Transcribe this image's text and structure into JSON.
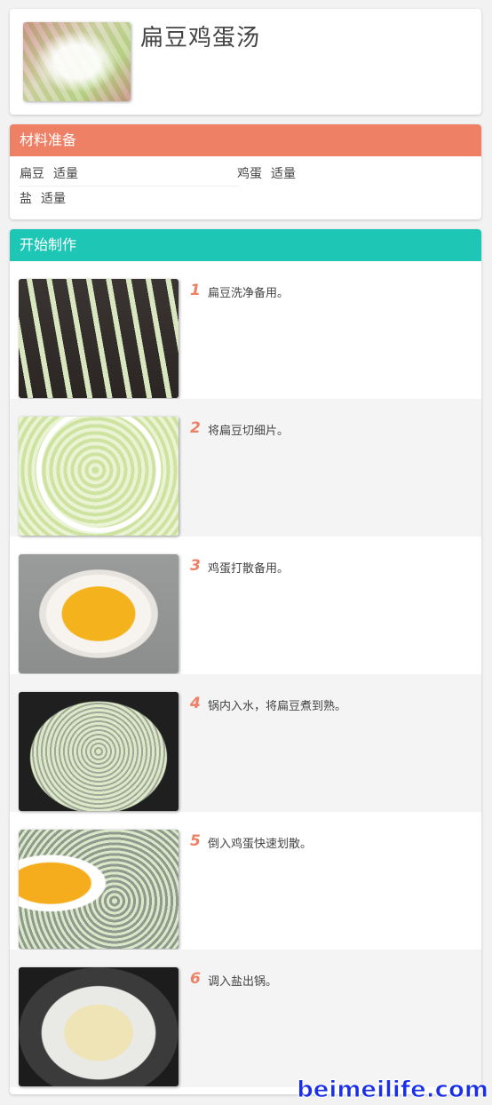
{
  "recipe": {
    "title": "扁豆鸡蛋汤"
  },
  "ingredients": {
    "heading": "材料准备",
    "items": [
      {
        "name": "扁豆",
        "qty": "适量"
      },
      {
        "name": "鸡蛋",
        "qty": "适量"
      },
      {
        "name": "盐",
        "qty": "适量"
      }
    ]
  },
  "steps": {
    "heading": "开始制作",
    "items": [
      {
        "num": "1",
        "text": "扁豆洗净备用。"
      },
      {
        "num": "2",
        "text": "将扁豆切细片。"
      },
      {
        "num": "3",
        "text": "鸡蛋打散备用。"
      },
      {
        "num": "4",
        "text": "锅内入水，将扁豆煮到熟。"
      },
      {
        "num": "5",
        "text": "倒入鸡蛋快速划散。"
      },
      {
        "num": "6",
        "text": "调入盐出锅。"
      }
    ]
  },
  "colors": {
    "accent_orange": "#ee8066",
    "accent_teal": "#1ec6b6",
    "watermark": "#1a2fe8"
  },
  "watermark": {
    "text": "beimeilife.com"
  }
}
